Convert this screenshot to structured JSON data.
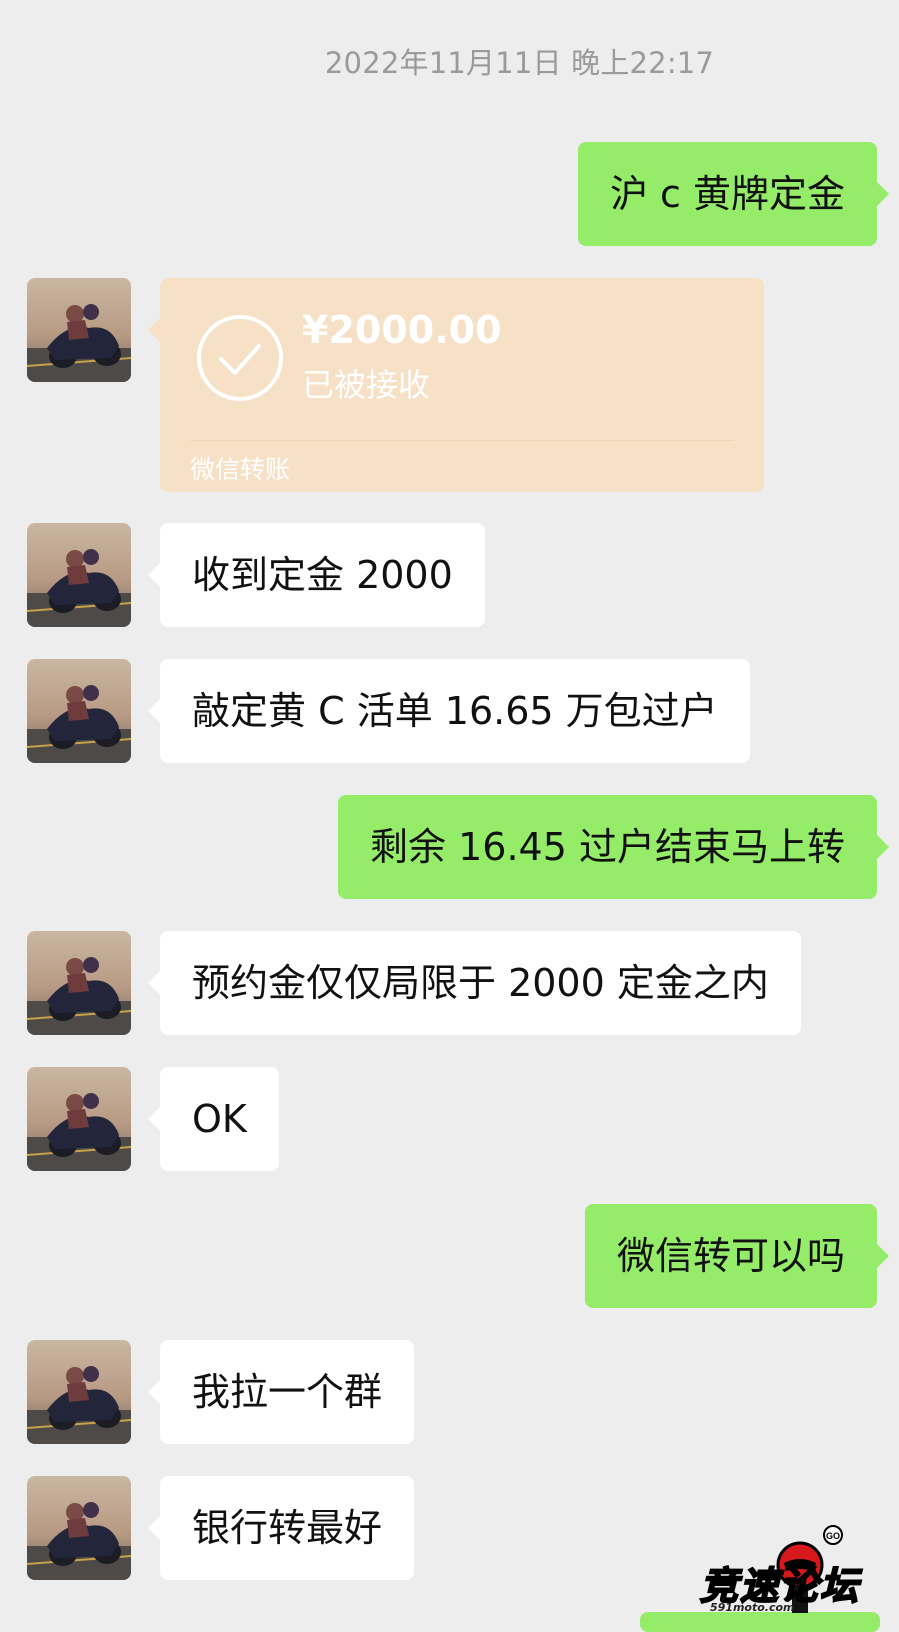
{
  "chat": {
    "timestamp": "2022年11月11日 晚上22:17",
    "messages": [
      {
        "side": "out",
        "text": "沪 c 黄牌定金"
      },
      {
        "side": "in",
        "type": "transfer",
        "amount": "¥2000.00",
        "status": "已被接收",
        "label": "微信转账"
      },
      {
        "side": "in",
        "text": "收到定金 2000"
      },
      {
        "side": "in",
        "text": "敲定黄 C 活单 16.65 万包过户"
      },
      {
        "side": "out",
        "text": "剩余 16.45  过户结束马上转"
      },
      {
        "side": "in",
        "text": "预约金仅仅局限于 2000 定金之内"
      },
      {
        "side": "in",
        "text": "OK"
      },
      {
        "side": "out",
        "text": "微信转可以吗"
      },
      {
        "side": "in",
        "text": "我拉一个群"
      },
      {
        "side": "in",
        "text": "银行转最好"
      }
    ]
  },
  "watermark": {
    "brand": "竞速论坛",
    "site": "591moto.com",
    "badge": "GO"
  },
  "colors": {
    "background": "#ededed",
    "outgoing_bubble": "#95ec69",
    "incoming_bubble": "#ffffff",
    "transfer_card": "#f6e0c6"
  },
  "icons": {
    "avatar": "motorcycle-rider-photo",
    "transfer_check": "check-circle-icon"
  }
}
